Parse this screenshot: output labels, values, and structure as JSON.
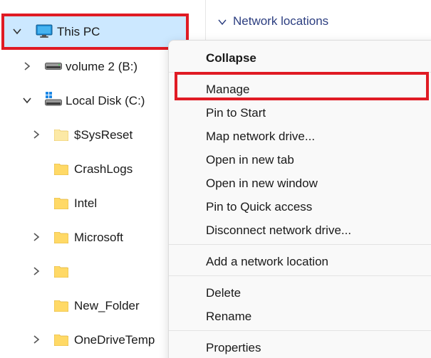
{
  "nav_tree": {
    "this_pc": {
      "label": "This PC",
      "icon": "monitor-icon",
      "expanded": true
    },
    "items": [
      {
        "label": "volume 2 (B:)",
        "icon": "drive-icon",
        "chevron": "right"
      },
      {
        "label": "Local Disk (C:)",
        "icon": "windows-drive-icon",
        "chevron": "down"
      },
      {
        "label": "$SysReset",
        "icon": "folder-icon",
        "chevron": "right"
      },
      {
        "label": "CrashLogs",
        "icon": "folder-icon",
        "chevron": ""
      },
      {
        "label": "Intel",
        "icon": "folder-icon",
        "chevron": ""
      },
      {
        "label": "Microsoft",
        "icon": "folder-icon",
        "chevron": "right"
      },
      {
        "label": "",
        "icon": "folder-icon",
        "chevron": "right"
      },
      {
        "label": "New_Folder",
        "icon": "folder-icon",
        "chevron": ""
      },
      {
        "label": "OneDriveTemp",
        "icon": "folder-icon",
        "chevron": "right"
      }
    ]
  },
  "content": {
    "section_header": "Network locations"
  },
  "context_menu": {
    "collapse": "Collapse",
    "manage": "Manage",
    "pin_to_start": "Pin to Start",
    "map_network_drive": "Map network drive...",
    "open_in_new_tab": "Open in new tab",
    "open_in_new_window": "Open in new window",
    "pin_to_quick_access": "Pin to Quick access",
    "disconnect_network_drive": "Disconnect network drive...",
    "add_network_location": "Add a network location",
    "delete": "Delete",
    "rename": "Rename",
    "properties": "Properties"
  },
  "colors": {
    "selection_bg": "#cce8ff",
    "highlight_border": "#e01b24",
    "folder_yellow": "#ffd966",
    "header_blue": "#2c3e80"
  }
}
